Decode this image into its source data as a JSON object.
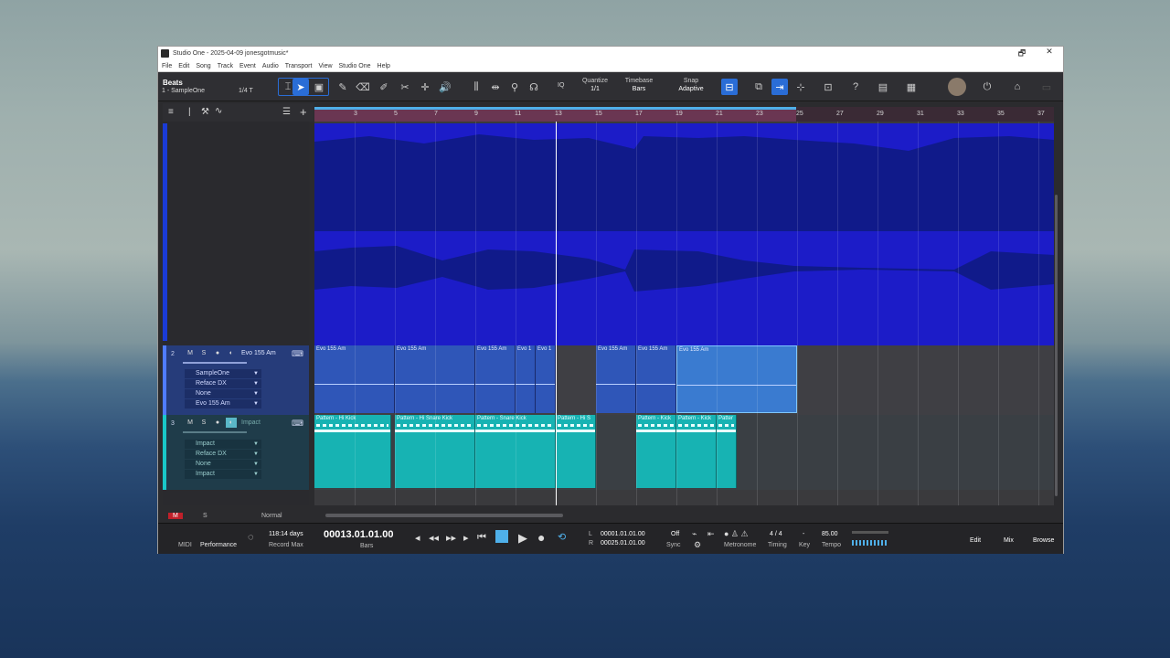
{
  "window": {
    "title": "Studio One - 2025-04-09 jonesgotmusic*",
    "controls": [
      "🗗",
      "✕"
    ]
  },
  "menu": [
    "File",
    "Edit",
    "Song",
    "Track",
    "Event",
    "Audio",
    "Transport",
    "View",
    "Studio One",
    "Help"
  ],
  "toolbar": {
    "song_name": "Beats",
    "song_sub": "1 - SampleOne",
    "grid_value": "1/4 T",
    "iq_label": "IQ",
    "quantize_label": "Quantize",
    "quantize_value": "1/1",
    "timebase_label": "Timebase",
    "timebase_value": "Bars",
    "snap_label": "Snap",
    "snap_value": "Adaptive",
    "help_icon": "?"
  },
  "ruler": {
    "marks": [
      "3",
      "5",
      "7",
      "9",
      "11",
      "13",
      "15",
      "17",
      "19",
      "21",
      "23",
      "25",
      "27",
      "29",
      "31",
      "33",
      "35",
      "37"
    ]
  },
  "tracks": {
    "track2": {
      "number": "2",
      "mute": "M",
      "solo": "S",
      "name": "Evo 155 Am",
      "inserts": [
        "SampleOne",
        "Reface DX",
        "None",
        "Evo 155 Am"
      ]
    },
    "track3": {
      "number": "3",
      "mute": "M",
      "solo": "S",
      "name": "Impact",
      "inserts": [
        "Impact",
        "Reface DX",
        "None",
        "Impact"
      ]
    }
  },
  "events": {
    "evo": [
      "Evo 155 Am",
      "Evo 155 Am",
      "Evo 155 Am",
      "Evo 1",
      "Evo 1",
      "Evo 155 Am",
      "Evo 155 Am",
      "Evo 155 Am"
    ],
    "patterns": [
      "Pattern - Hi Kick",
      "Pattern - Hi Snare Kick",
      "Pattern - Snare Kick",
      "Pattern - Hi S",
      "Pattern - Kick",
      "Pattern - Kick",
      "Patter"
    ]
  },
  "bottom_strip": {
    "m_label": "M",
    "s_label": "S",
    "mode": "Normal"
  },
  "transport": {
    "midi_label": "MIDI",
    "performance_label": "Performance",
    "record_max_value": "118:14 days",
    "record_max_label": "Record Max",
    "position": "00013.01.01.00",
    "position_unit": "Bars",
    "loop_l_label": "L",
    "loop_l": "00001.01.01.00",
    "loop_r_label": "R",
    "loop_r": "00025.01.01.00",
    "sync_value": "Off",
    "sync_label": "Sync",
    "metronome_label": "Metronome",
    "timing_value": "4 / 4",
    "timing_label": "Timing",
    "key_value": "-",
    "key_label": "Key",
    "tempo_value": "85.00",
    "tempo_label": "Tempo",
    "edit_label": "Edit",
    "mix_label": "Mix",
    "browse_label": "Browse"
  },
  "colors": {
    "accent": "#2a6dd6",
    "audio_track": "#1c1cc8",
    "instrument_event": "#2f56b8",
    "pattern_event": "#17b3b3",
    "loop_band": "#6a3652"
  }
}
